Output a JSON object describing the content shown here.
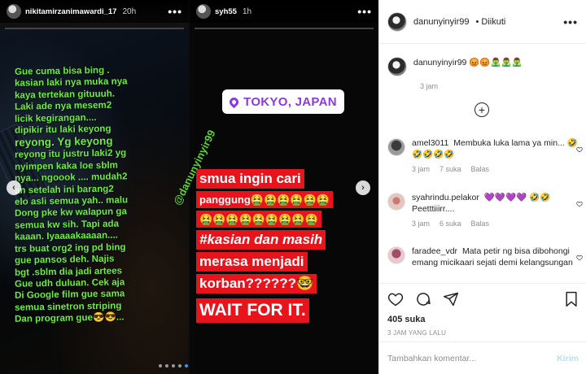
{
  "story1": {
    "username": "nikitamirzanimawardi_17",
    "time": "20h",
    "more": "•••",
    "lines": [
      "Gue cuma bisa bing .",
      "kasian laki nya muka nya",
      "kaya tertekan gituuuh.",
      "Laki ade nya mesem2",
      "licik kegirangan....",
      "dipikir itu laki keyong",
      "reyong. Yg keyong",
      "reyong itu justru laki2 yg",
      "nyimpen kaka loe sblm",
      "nya... ngoook .... mudah2",
      "an setelah ini barang2",
      "elo asli semua yah.. malu",
      "Dong pke kw walapun ga",
      "semua kw sih. Tapi ada",
      "kaaan. Iyaaaakaaaan....",
      "trs buat org2 ing pd bing",
      "gue pansos deh. Najis",
      "bgt .sblm dia jadi artees",
      "Gue udh duluan. Cek aja",
      "Di Google film gue sama",
      "semua sinetron striping",
      "Dan program gue😎😎..."
    ],
    "mention": "@danunyinyir99"
  },
  "story2": {
    "username": "syh55",
    "time": "1h",
    "more": "•••",
    "location": "TOKYO, JAPAN",
    "lines": [
      "smua ingin cari",
      "panggung🤮🤮🤮🤮🤮🤮",
      "🤮🤮🤮🤮🤮🤮🤮🤮🤮",
      "#kasian dan masih",
      "merasa menjadi",
      "korban??????🤓",
      "WAIT FOR IT."
    ]
  },
  "nav": {
    "prev": "‹",
    "next": "›"
  },
  "pagination": {
    "count": 5,
    "active": 4
  },
  "post": {
    "author": "danunyinyir99",
    "follow_status": "• Diikuti",
    "more": "•••",
    "caption": "😡😡🧟‍♂️🧟‍♂️🧟‍♂️",
    "caption_time": "3 jam",
    "load_more": "+",
    "comments": [
      {
        "user": "amel3011",
        "text": "Membuka luka lama ya min... 🤣🤣🤣🤣🤣",
        "time": "3 jam",
        "likes": "7 suka",
        "reply": "Balas"
      },
      {
        "user": "syahrindu.pelakor",
        "text": "💜💜💜💜 🤣🤣 Peetttiiirr....",
        "time": "3 jam",
        "likes": "6 suka",
        "reply": "Balas"
      },
      {
        "user": "faradee_vdr",
        "text": "Mata petir ng bisa dibohongi emang micikaari sejati demi kelangsungan",
        "time": "",
        "likes": "",
        "reply": ""
      }
    ],
    "likes_count": "405 suka",
    "posted_ago": "3 JAM YANG LALU",
    "comment_placeholder": "Tambahkan komentar...",
    "send_label": "Kirim"
  },
  "colors": {
    "story_text_green": "#6cef3c",
    "banner_red": "#e8141c",
    "location_purple": "#8a3be0",
    "send_disabled": "#b2dffc",
    "muted": "#8e8e8e",
    "pagination_active": "#3b95f5"
  }
}
